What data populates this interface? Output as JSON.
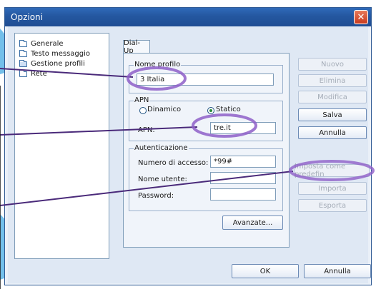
{
  "window": {
    "title": "Opzioni",
    "close_glyph": "✕"
  },
  "tree": {
    "items": [
      {
        "label": "Generale",
        "icon": "folder-icon"
      },
      {
        "label": "Testo messaggio",
        "icon": "folder-icon"
      },
      {
        "label": "Gestione profili",
        "icon": "folder-open-icon"
      },
      {
        "label": "Rete",
        "icon": "folder-icon"
      }
    ]
  },
  "tabs": [
    {
      "label": "Dial-Up"
    }
  ],
  "profile": {
    "legend": "Nome profilo",
    "value": "3 Italia"
  },
  "apn": {
    "legend": "APN",
    "option_dynamic": "Dinamico",
    "option_static": "Statico",
    "selected": "Statico",
    "field_label": "APN:",
    "value": "tre.it"
  },
  "auth": {
    "legend": "Autenticazione",
    "access_number_label": "Numero di accesso:",
    "access_number_value": "*99#",
    "username_label": "Nome utente:",
    "username_value": "",
    "password_label": "Password:",
    "password_value": ""
  },
  "buttons": {
    "advanced": "Avanzate...",
    "new": "Nuovo",
    "delete": "Elimina",
    "modify": "Modifica",
    "save": "Salva",
    "cancel_side": "Annulla",
    "set_default": "Imposta come predefin",
    "import": "Importa",
    "export": "Esporta",
    "ok": "OK",
    "cancel": "Annulla"
  },
  "colors": {
    "titlebar": "#2457a0",
    "annotation_line": "#4a2a7a",
    "highlight_ring": "#8e5fc8",
    "swoosh": "#5ab4e6"
  }
}
